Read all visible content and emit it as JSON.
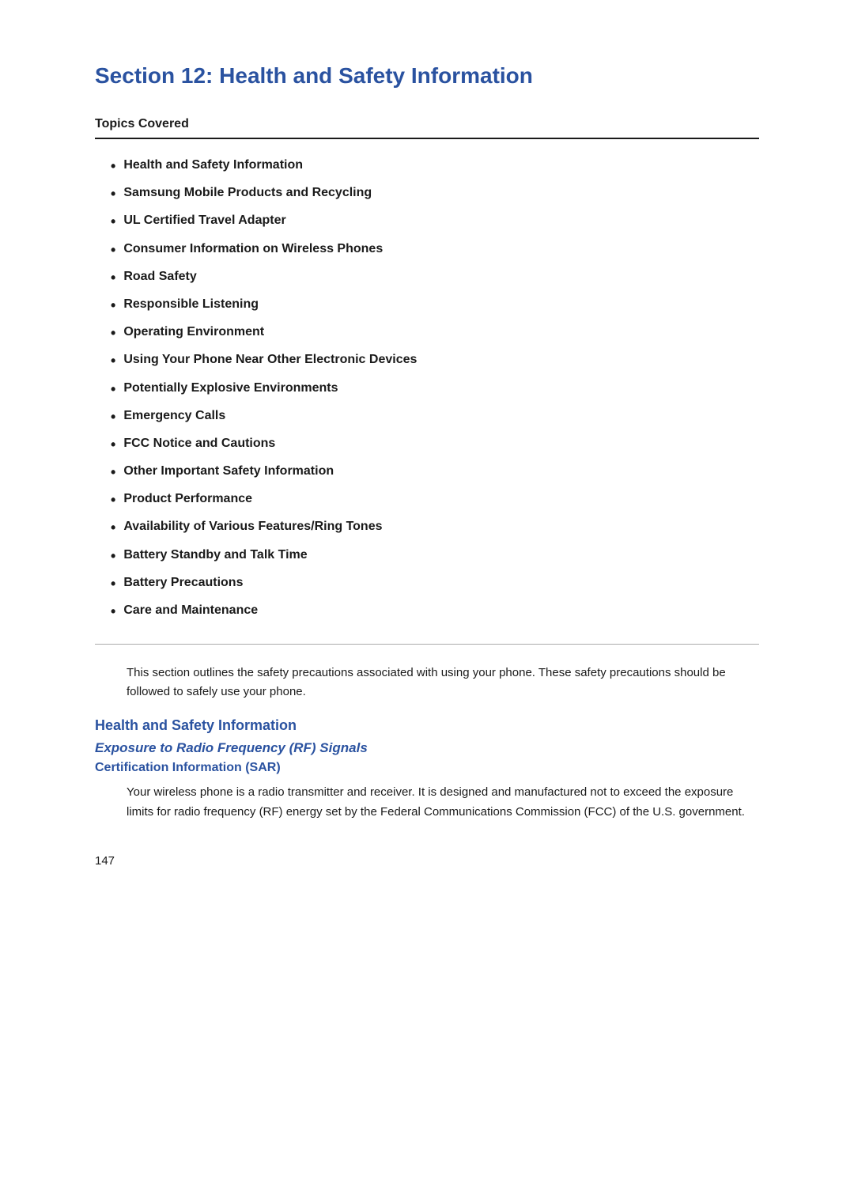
{
  "header": {
    "title": "Section 12: Health and Safety Information"
  },
  "topics_covered": {
    "label": "Topics Covered",
    "items": [
      "Health and Safety Information",
      "Samsung Mobile Products and Recycling",
      "UL Certified Travel Adapter",
      "Consumer Information on Wireless Phones",
      "Road Safety",
      "Responsible Listening",
      "Operating Environment",
      "Using Your Phone Near Other Electronic Devices",
      "Potentially Explosive Environments",
      "Emergency Calls",
      "FCC Notice and Cautions",
      "Other Important Safety Information",
      "Product Performance",
      "Availability of Various Features/Ring Tones",
      "Battery Standby and Talk Time",
      "Battery Precautions",
      "Care and Maintenance"
    ]
  },
  "intro": {
    "text": "This section outlines the safety precautions associated with using your phone. These safety precautions should be followed to safely use your phone."
  },
  "health_section": {
    "heading": "Health and Safety Information",
    "subheading_italic": "Exposure to Radio Frequency (RF) Signals",
    "subheading": "Certification Information (SAR)",
    "body": "Your wireless phone is a radio transmitter and receiver. It is designed and manufactured not to exceed the exposure limits for radio frequency (RF) energy set by the Federal Communications Commission (FCC) of the U.S. government."
  },
  "page_number": "147"
}
